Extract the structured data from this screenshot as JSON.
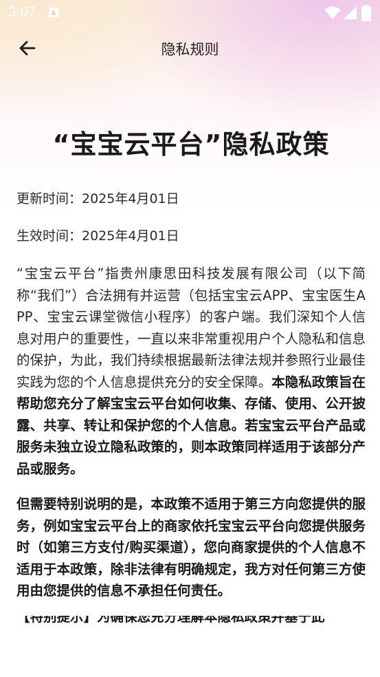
{
  "status": {
    "time": "3:07"
  },
  "appbar": {
    "title": "隐私规则"
  },
  "doc": {
    "title": "“宝宝云平台”隐私政策",
    "updated": "更新时间：2025年4月01日",
    "effective": "生效时间：2025年4月01日",
    "p1_normal": "“宝宝云平台”指贵州康思田科技发展有限公司（以下简称“我们”）合法拥有并运营（包括宝宝云APP、宝宝医生APP、宝宝云课堂微信小程序）的客户端。我们深知个人信息对用户的重要性，一直以来非常重视用户个人隐私和信息的保护，为此，我们持续根据最新法律法规并参照行业最佳实践为您的个人信息提供充分的安全保障。",
    "p1_bold": "本隐私政策旨在帮助您充分了解宝宝云平台如何收集、存储、使用、公开披露、共享、转让和保护您的个人信息。若宝宝云平台产品或服务未独立设立隐私政策的，则本政策同样适用于该部分产品或服务。",
    "p2_bold": "但需要特别说明的是，本政策不适用于第三方向您提供的服务，例如宝宝云平台上的商家依托宝宝云平台向您提供服务时（如第三方支付/购买渠道），您向商家提供的个人信息不适用于本政策，除非法律有明确规定，我方对任何第三方使用由您提供的信息不承担任何责任。",
    "p3_partial": "【特别提示】为确保您充分理解本隐私政策并基于此"
  }
}
